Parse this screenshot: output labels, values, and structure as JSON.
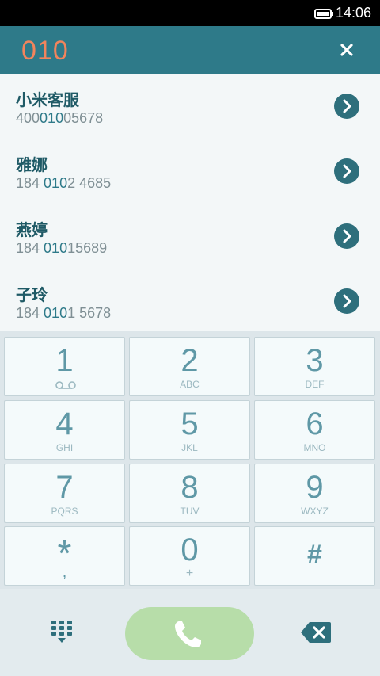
{
  "status_bar": {
    "time": "14:06"
  },
  "header": {
    "dialed_number": "010"
  },
  "contacts": [
    {
      "name": "小米客服",
      "number_pre": "400",
      "number_match": "010",
      "number_post": "05678"
    },
    {
      "name": "雅娜",
      "number_pre": "184 ",
      "number_match": "010",
      "number_post": "2 4685"
    },
    {
      "name": "燕婷",
      "number_pre": "184 ",
      "number_match": "010",
      "number_post": "15689"
    },
    {
      "name": "子玲",
      "number_pre": "184 ",
      "number_match": "010",
      "number_post": "1 5678"
    }
  ],
  "keypad": [
    {
      "digit": "1",
      "letters": ""
    },
    {
      "digit": "2",
      "letters": "ABC"
    },
    {
      "digit": "3",
      "letters": "DEF"
    },
    {
      "digit": "4",
      "letters": "GHI"
    },
    {
      "digit": "5",
      "letters": "JKL"
    },
    {
      "digit": "6",
      "letters": "MNO"
    },
    {
      "digit": "7",
      "letters": "PQRS"
    },
    {
      "digit": "8",
      "letters": "TUV"
    },
    {
      "digit": "9",
      "letters": "WXYZ"
    },
    {
      "digit": "*",
      "letters": ","
    },
    {
      "digit": "0",
      "letters": "+"
    },
    {
      "digit": "#",
      "letters": ""
    }
  ],
  "icons": {
    "battery": "battery-icon",
    "close": "close-icon",
    "arrow": "chevron-right-icon",
    "voicemail": "voicemail-icon",
    "call": "phone-icon",
    "dialpad": "dialpad-icon",
    "backspace": "backspace-icon"
  },
  "colors": {
    "header_bg": "#2e7a89",
    "dialed_text": "#f2845c",
    "call_button": "#b7dda9",
    "key_digit": "#5f98a6",
    "accent_dark": "#2e6f7c"
  }
}
